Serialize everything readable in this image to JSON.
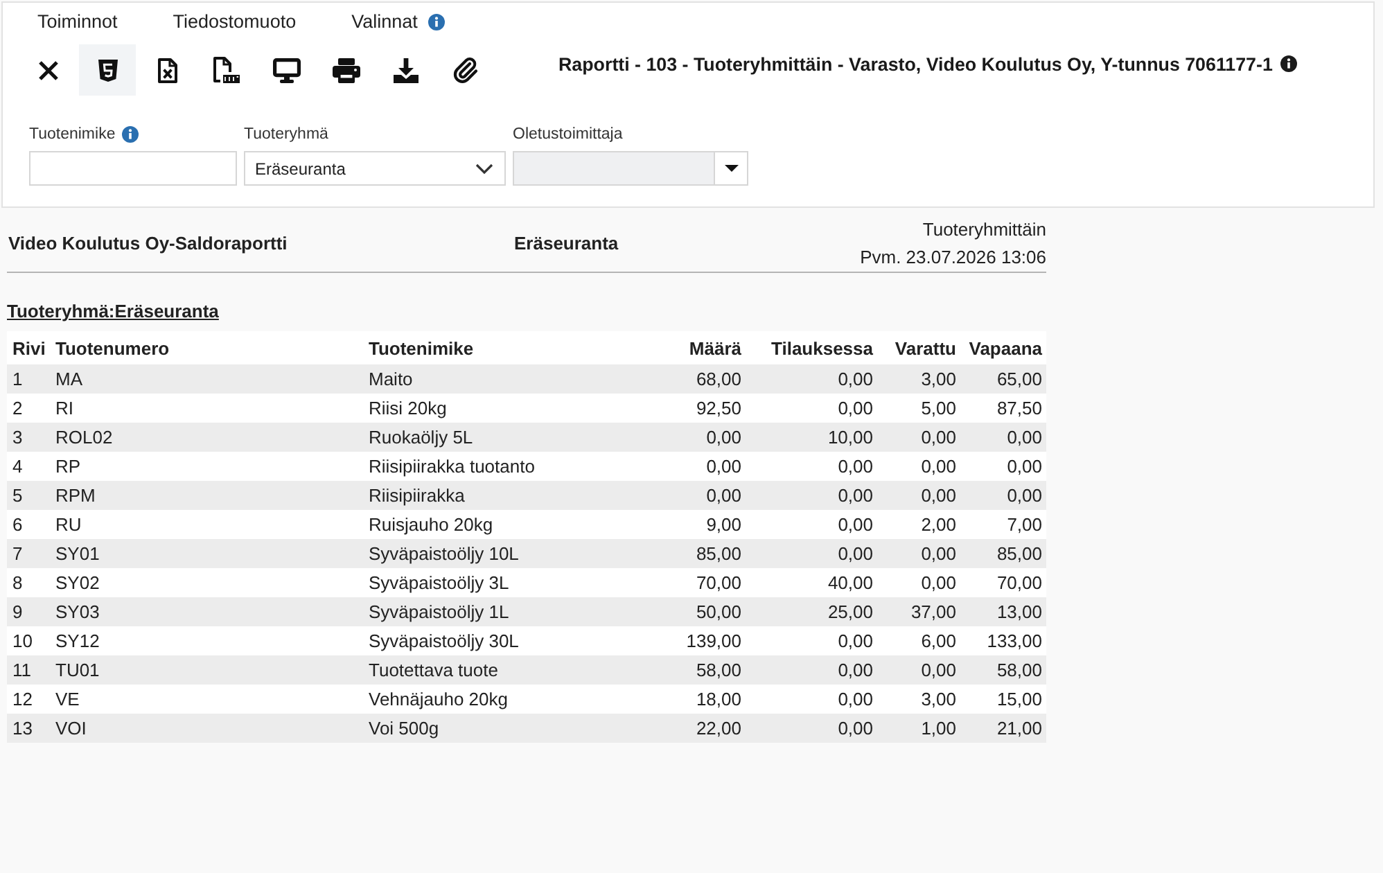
{
  "menu": [
    {
      "label": "Toiminnot",
      "info": false
    },
    {
      "label": "Tiedostomuoto",
      "info": false
    },
    {
      "label": "Valinnat",
      "info": true
    }
  ],
  "toolbar": [
    {
      "kind": "close",
      "selected": false
    },
    {
      "kind": "html",
      "selected": true
    },
    {
      "kind": "excel",
      "selected": false
    },
    {
      "kind": "pdf",
      "selected": false
    },
    {
      "kind": "screen",
      "selected": false
    },
    {
      "kind": "print",
      "selected": false
    },
    {
      "kind": "download",
      "selected": false
    },
    {
      "kind": "attach",
      "selected": false
    }
  ],
  "title": {
    "text": "Raportti - 103 - Tuoteryhmittäin - Varasto, Video Koulutus Oy, Y-tunnus 7061177-1",
    "info": true
  },
  "filters": [
    {
      "label": "Tuotenimike",
      "info": true,
      "kind": "text",
      "disabled": false
    },
    {
      "label": "Tuoteryhmä",
      "info": false,
      "kind": "select",
      "value": "Eräseuranta",
      "disabled": false
    },
    {
      "label": "Oletustoimittaja",
      "info": false,
      "kind": "select",
      "disabled": true
    }
  ],
  "report": {
    "company": "Video Koulutus Oy-Saldoraportti",
    "group": "Eräseuranta",
    "grouping": "Tuoteryhmittäin",
    "date": "Pvm. 23.07.2026 13:06",
    "section": "Tuoteryhmä:Eräseuranta",
    "columns": [
      "Rivi",
      "Tuotenumero",
      "Tuotenimike",
      "Määrä",
      "Tilauksessa",
      "Varattu",
      "Vapaana"
    ],
    "rows": [
      [
        "1",
        "MA",
        "Maito",
        "68,00",
        "0,00",
        "3,00",
        "65,00"
      ],
      [
        "2",
        "RI",
        "Riisi 20kg",
        "92,50",
        "0,00",
        "5,00",
        "87,50"
      ],
      [
        "3",
        "ROL02",
        "Ruokaöljy 5L",
        "0,00",
        "10,00",
        "0,00",
        "0,00"
      ],
      [
        "4",
        "RP",
        "Riisipiirakka tuotanto",
        "0,00",
        "0,00",
        "0,00",
        "0,00"
      ],
      [
        "5",
        "RPM",
        "Riisipiirakka",
        "0,00",
        "0,00",
        "0,00",
        "0,00"
      ],
      [
        "6",
        "RU",
        "Ruisjauho 20kg",
        "9,00",
        "0,00",
        "2,00",
        "7,00"
      ],
      [
        "7",
        "SY01",
        "Syväpaistoöljy 10L",
        "85,00",
        "0,00",
        "0,00",
        "85,00"
      ],
      [
        "8",
        "SY02",
        "Syväpaistoöljy 3L",
        "70,00",
        "40,00",
        "0,00",
        "70,00"
      ],
      [
        "9",
        "SY03",
        "Syväpaistoöljy 1L",
        "50,00",
        "25,00",
        "37,00",
        "13,00"
      ],
      [
        "10",
        "SY12",
        "Syväpaistoöljy 30L",
        "139,00",
        "0,00",
        "6,00",
        "133,00"
      ],
      [
        "11",
        "TU01",
        "Tuotettava tuote",
        "58,00",
        "0,00",
        "0,00",
        "58,00"
      ],
      [
        "12",
        "VE",
        "Vehnäjauho 20kg",
        "18,00",
        "0,00",
        "3,00",
        "15,00"
      ],
      [
        "13",
        "VOI",
        "Voi 500g",
        "22,00",
        "0,00",
        "1,00",
        "21,00"
      ]
    ]
  }
}
